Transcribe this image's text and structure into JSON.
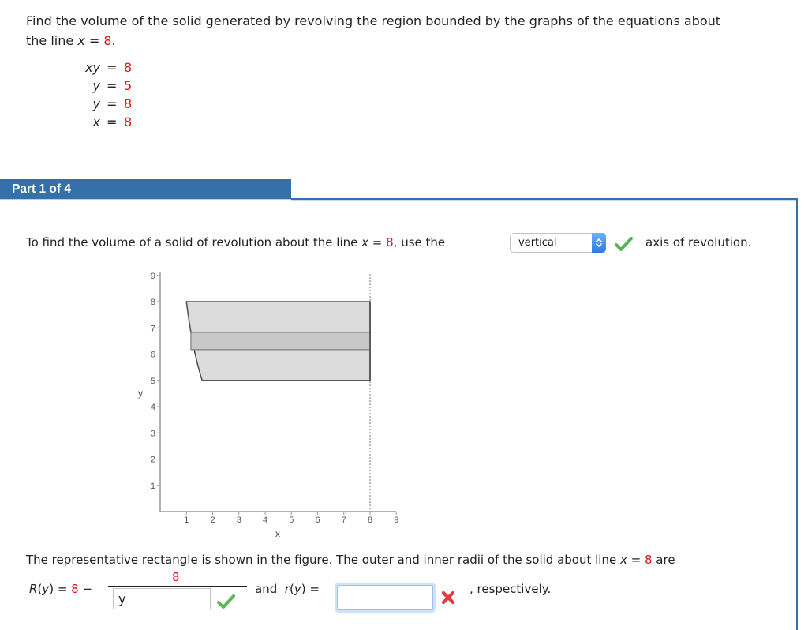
{
  "problem": {
    "line1": "Find the volume of the solid generated by revolving the region bounded by the graphs of the equations about",
    "line2_prefix": "the line ",
    "var": "x",
    "eq": " = ",
    "value": "8",
    "suffix": "."
  },
  "equations": [
    {
      "lhs": "xy",
      "eq": "=",
      "value": "8"
    },
    {
      "lhs": "y",
      "eq": "=",
      "value": "5"
    },
    {
      "lhs": "y",
      "eq": "=",
      "value": "8"
    },
    {
      "lhs": "x",
      "eq": "=",
      "value": "8"
    }
  ],
  "part": {
    "label": "Part 1 of 4"
  },
  "question": {
    "prefix": "To find the volume of a solid of revolution about the line ",
    "var": "x",
    "eq": " = ",
    "value": "8",
    "mid": ", use the",
    "select_value": "vertical",
    "select_status": "correct",
    "suffix": "axis of revolution."
  },
  "figure": {
    "x_ticks": [
      "1",
      "2",
      "3",
      "4",
      "5",
      "6",
      "7",
      "8",
      "9"
    ],
    "y_ticks": [
      "1",
      "2",
      "3",
      "4",
      "5",
      "6",
      "7",
      "8",
      "9"
    ],
    "xlabel": "x",
    "ylabel": "y",
    "x_range": [
      0,
      9
    ],
    "y_range": [
      0,
      9.1
    ],
    "curve_k": 8,
    "region": {
      "y_min": 5,
      "y_max": 8,
      "x_right": 8
    },
    "rectangle": {
      "y_bottom": 6.17,
      "y_top": 6.83
    },
    "axis_of_revolution_x": 8,
    "colors": {
      "region_fill": "#dcdcdc",
      "region_stroke": "#555555",
      "rect_fill": "#c8c8c8",
      "rect_stroke": "#7a7a7a",
      "axis": "#9a9a9a"
    }
  },
  "radii": {
    "intro": "The representative rectangle is shown in the figure. The outer and inner radii of the solid about line ",
    "var": "x",
    "eq": " = ",
    "value": "8",
    "intro_suffix": " are",
    "R_name": "R",
    "R_var": "y",
    "R_eq": " = ",
    "R_const": "8",
    "R_minus": " −",
    "R_numerator": "8",
    "R_denominator_value": "y",
    "R_status": "correct",
    "and": "and",
    "r_name": "r",
    "r_var": "y",
    "r_eq": " =",
    "r_value": "",
    "r_status": "incorrect",
    "respectively": ",  respectively."
  },
  "colors": {
    "accent": "#3470aa",
    "highlight_red": "#e3121e",
    "correct_green": "#5cb85c",
    "incorrect_red": "#e23b3b"
  }
}
